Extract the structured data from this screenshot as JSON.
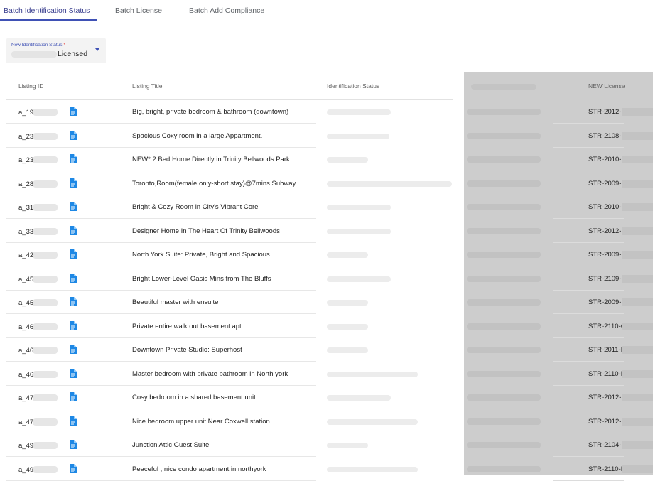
{
  "tabs": [
    {
      "label": "Batch Identification Status",
      "active": true
    },
    {
      "label": "Batch License",
      "active": false
    },
    {
      "label": "Batch Add Compliance",
      "active": false
    }
  ],
  "status_select": {
    "label": "New Identification Status",
    "required_mark": "*",
    "value_visible": "Licensed"
  },
  "table": {
    "headers": {
      "listing_id": "Listing ID",
      "listing_title": "Listing Title",
      "identification_status": "Identification Status",
      "new_license": "NEW License"
    },
    "rows": [
      {
        "id": "a_19",
        "title": "Big, bright, private bedroom & bathroom (downtown)",
        "license": "STR-2012-F",
        "ident_w": 90
      },
      {
        "id": "a_23",
        "title": "Spacious Coxy room in a large Appartment.",
        "license": "STR-2108-F",
        "ident_w": 88
      },
      {
        "id": "a_23",
        "title": "NEW* 2 Bed Home Directly in Trinity Bellwoods Park",
        "license": "STR-2010-C",
        "ident_w": 58
      },
      {
        "id": "a_28",
        "title": "Toronto,Room(female only-short stay)@7mins Subway",
        "license": "STR-2009-F",
        "ident_w": 176
      },
      {
        "id": "a_31",
        "title": "Bright & Cozy Room in City's Vibrant Core",
        "license": "STR-2010-C",
        "ident_w": 90
      },
      {
        "id": "a_33",
        "title": "Designer Home In The Heart Of Trinity Bellwoods",
        "license": "STR-2012-H",
        "ident_w": 90
      },
      {
        "id": "a_42",
        "title": "North York Suite: Private, Bright and Spacious",
        "license": "STR-2009-F",
        "ident_w": 58
      },
      {
        "id": "a_45",
        "title": "Bright Lower-Level Oasis Mins from The Bluffs",
        "license": "STR-2109-C",
        "ident_w": 90
      },
      {
        "id": "a_45",
        "title": "Beautiful master with ensuite",
        "license": "STR-2009-H",
        "ident_w": 58
      },
      {
        "id": "a_46",
        "title": "Private entire walk out basement apt",
        "license": "STR-2110-C",
        "ident_w": 58
      },
      {
        "id": "a_46",
        "title": "Downtown Private Studio: Superhost",
        "license": "STR-2011-F",
        "ident_w": 58
      },
      {
        "id": "a_46",
        "title": "Master bedroom with private bathroom in North york",
        "license": "STR-2110-H",
        "ident_w": 128
      },
      {
        "id": "a_47",
        "title": "Cosy bedroom in a shared basement unit.",
        "license": "STR-2012-H",
        "ident_w": 90
      },
      {
        "id": "a_47",
        "title": "Nice bedroom upper unit Near Coxwell station",
        "license": "STR-2012-F",
        "ident_w": 128
      },
      {
        "id": "a_49",
        "title": "Junction Attic Guest Suite",
        "license": "STR-2104-F",
        "ident_w": 58
      },
      {
        "id": "a_49",
        "title": "Peaceful , nice condo apartment in northyork",
        "license": "STR-2110-H",
        "ident_w": 128
      }
    ]
  },
  "colors": {
    "accent": "#3f51b5",
    "doc_icon": "#1e88e5",
    "required": "#e53935"
  },
  "icons": {
    "row_document": "document-icon",
    "select_caret": "caret-down-icon"
  }
}
